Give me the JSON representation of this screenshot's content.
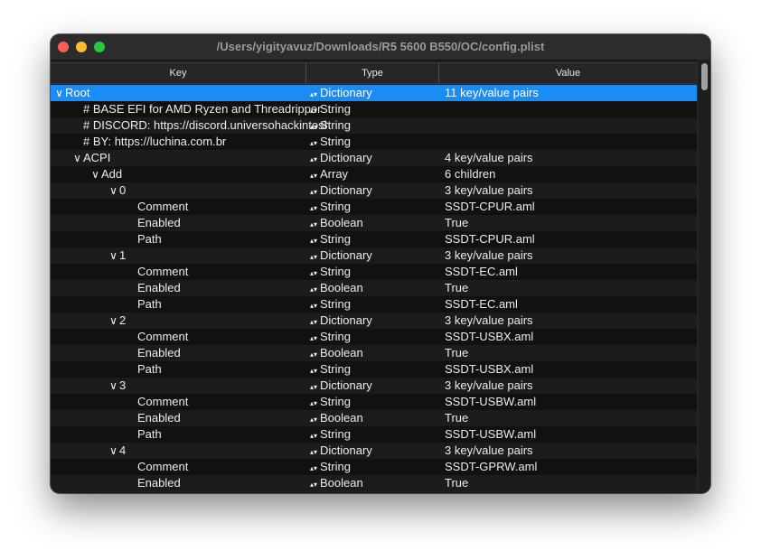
{
  "window": {
    "title": "/Users/yigityavuz/Downloads/R5 5600 B550/OC/config.plist"
  },
  "columns": {
    "key": "Key",
    "type": "Type",
    "value": "Value"
  },
  "icons": {
    "expanded": "chevron-down-icon",
    "stepper": "updown-stepper-icon"
  },
  "colors": {
    "selection": "#1a8cf6",
    "close": "#ff5f57",
    "minimize": "#febc2e",
    "maximize": "#28c840"
  },
  "rows": [
    {
      "key": "Root",
      "type": "Dictionary",
      "value": "11 key/value pairs",
      "level": 0,
      "expanded": true,
      "selected": true
    },
    {
      "key": "# BASE EFI for AMD Ryzen and Threadripper",
      "type": "String",
      "value": "",
      "level": 1,
      "expanded": false
    },
    {
      "key": "# DISCORD: https://discord.universohackintosh.com.br",
      "type": "String",
      "value": "",
      "level": 1,
      "expanded": false
    },
    {
      "key": "# BY: https://luchina.com.br",
      "type": "String",
      "value": "",
      "level": 1,
      "expanded": false
    },
    {
      "key": "ACPI",
      "type": "Dictionary",
      "value": "4 key/value pairs",
      "level": 1,
      "expanded": true
    },
    {
      "key": "Add",
      "type": "Array",
      "value": "6 children",
      "level": 2,
      "expanded": true
    },
    {
      "key": "0",
      "type": "Dictionary",
      "value": "3 key/value pairs",
      "level": 3,
      "expanded": true
    },
    {
      "key": "Comment",
      "type": "String",
      "value": "SSDT-CPUR.aml",
      "level": 4,
      "expanded": false
    },
    {
      "key": "Enabled",
      "type": "Boolean",
      "value": "True",
      "level": 4,
      "expanded": false
    },
    {
      "key": "Path",
      "type": "String",
      "value": "SSDT-CPUR.aml",
      "level": 4,
      "expanded": false
    },
    {
      "key": "1",
      "type": "Dictionary",
      "value": "3 key/value pairs",
      "level": 3,
      "expanded": true
    },
    {
      "key": "Comment",
      "type": "String",
      "value": "SSDT-EC.aml",
      "level": 4,
      "expanded": false
    },
    {
      "key": "Enabled",
      "type": "Boolean",
      "value": "True",
      "level": 4,
      "expanded": false
    },
    {
      "key": "Path",
      "type": "String",
      "value": "SSDT-EC.aml",
      "level": 4,
      "expanded": false
    },
    {
      "key": "2",
      "type": "Dictionary",
      "value": "3 key/value pairs",
      "level": 3,
      "expanded": true
    },
    {
      "key": "Comment",
      "type": "String",
      "value": "SSDT-USBX.aml",
      "level": 4,
      "expanded": false
    },
    {
      "key": "Enabled",
      "type": "Boolean",
      "value": "True",
      "level": 4,
      "expanded": false
    },
    {
      "key": "Path",
      "type": "String",
      "value": "SSDT-USBX.aml",
      "level": 4,
      "expanded": false
    },
    {
      "key": "3",
      "type": "Dictionary",
      "value": "3 key/value pairs",
      "level": 3,
      "expanded": true
    },
    {
      "key": "Comment",
      "type": "String",
      "value": "SSDT-USBW.aml",
      "level": 4,
      "expanded": false
    },
    {
      "key": "Enabled",
      "type": "Boolean",
      "value": "True",
      "level": 4,
      "expanded": false
    },
    {
      "key": "Path",
      "type": "String",
      "value": "SSDT-USBW.aml",
      "level": 4,
      "expanded": false
    },
    {
      "key": "4",
      "type": "Dictionary",
      "value": "3 key/value pairs",
      "level": 3,
      "expanded": true
    },
    {
      "key": "Comment",
      "type": "String",
      "value": "SSDT-GPRW.aml",
      "level": 4,
      "expanded": false
    },
    {
      "key": "Enabled",
      "type": "Boolean",
      "value": "True",
      "level": 4,
      "expanded": false
    }
  ]
}
